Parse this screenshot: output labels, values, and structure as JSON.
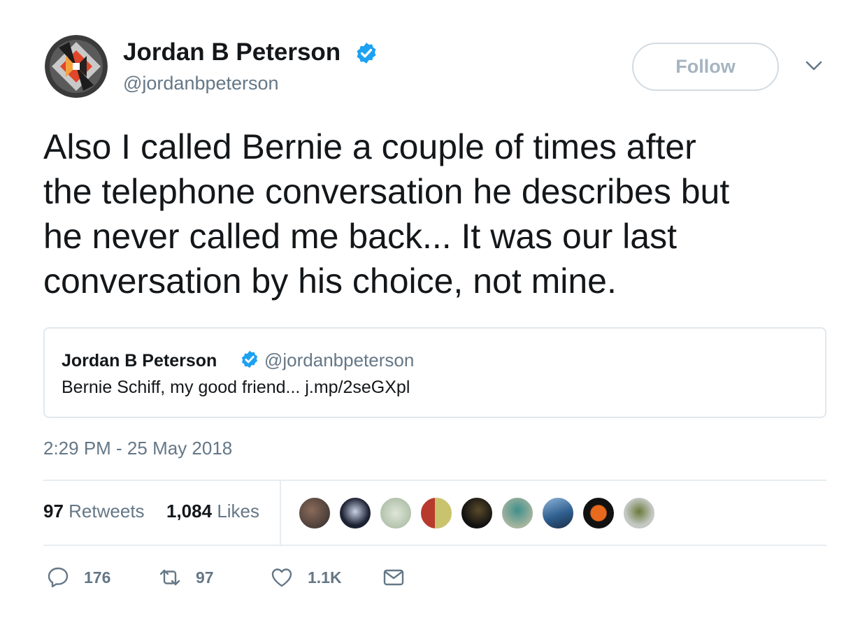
{
  "header": {
    "name": "Jordan B Peterson",
    "handle": "@jordanbpeterson",
    "follow_label": "Follow"
  },
  "tweet": {
    "text_lines": [
      "Also I called Bernie a couple of times after",
      "the telephone conversation he describes but",
      "he never called me back... It was our last",
      "conversation by his choice, not mine."
    ]
  },
  "quoted_tweet": {
    "name": "Jordan B Peterson",
    "handle": "@jordanbpeterson",
    "text": "Bernie Schiff, my good friend... j.mp/2seGXpl"
  },
  "timestamp": "2:29 PM - 25 May 2018",
  "stats": {
    "retweets_count": "97",
    "retweets_label": "Retweets",
    "likes_count": "1,084",
    "likes_label": "Likes"
  },
  "actions": {
    "reply_count": "176",
    "retweet_count": "97",
    "like_count": "1.1K"
  },
  "colors": {
    "verified": "#1da1f2",
    "secondary_text": "#657786",
    "primary_text": "#14171a"
  }
}
